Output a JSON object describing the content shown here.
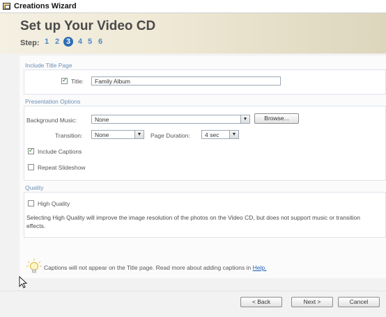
{
  "window": {
    "title": "Creations Wizard"
  },
  "header": {
    "title": "Set up Your Video CD",
    "step_label": "Step:",
    "steps": [
      "1",
      "2",
      "3",
      "4",
      "5",
      "6"
    ],
    "current_step": "3"
  },
  "title_page": {
    "section_label": "Include Title Page",
    "title_label": "Title:",
    "title_value": "Family Album",
    "title_checked": true
  },
  "presentation": {
    "section_label": "Presentation Options",
    "music_label": "Background Music:",
    "music_value": "None",
    "browse_label": "Browse...",
    "transition_label": "Transition:",
    "transition_value": "None",
    "duration_label": "Page Duration:",
    "duration_value": "4 sec",
    "captions_label": "Include Captions",
    "captions_checked": true,
    "repeat_label": "Repeat Slideshow",
    "repeat_checked": false
  },
  "quality": {
    "section_label": "Quality",
    "high_quality_label": "High Quality",
    "high_quality_checked": false,
    "note": "Selecting High Quality will improve the image resolution of the photos on the Video CD, but does not support music or transition effects."
  },
  "tip": {
    "text": "Captions will not appear on the Title page. Read more about adding captions in",
    "link": "Help."
  },
  "footer": {
    "back_label": "< Back",
    "next_label": "Next >",
    "cancel_label": "Cancel"
  }
}
